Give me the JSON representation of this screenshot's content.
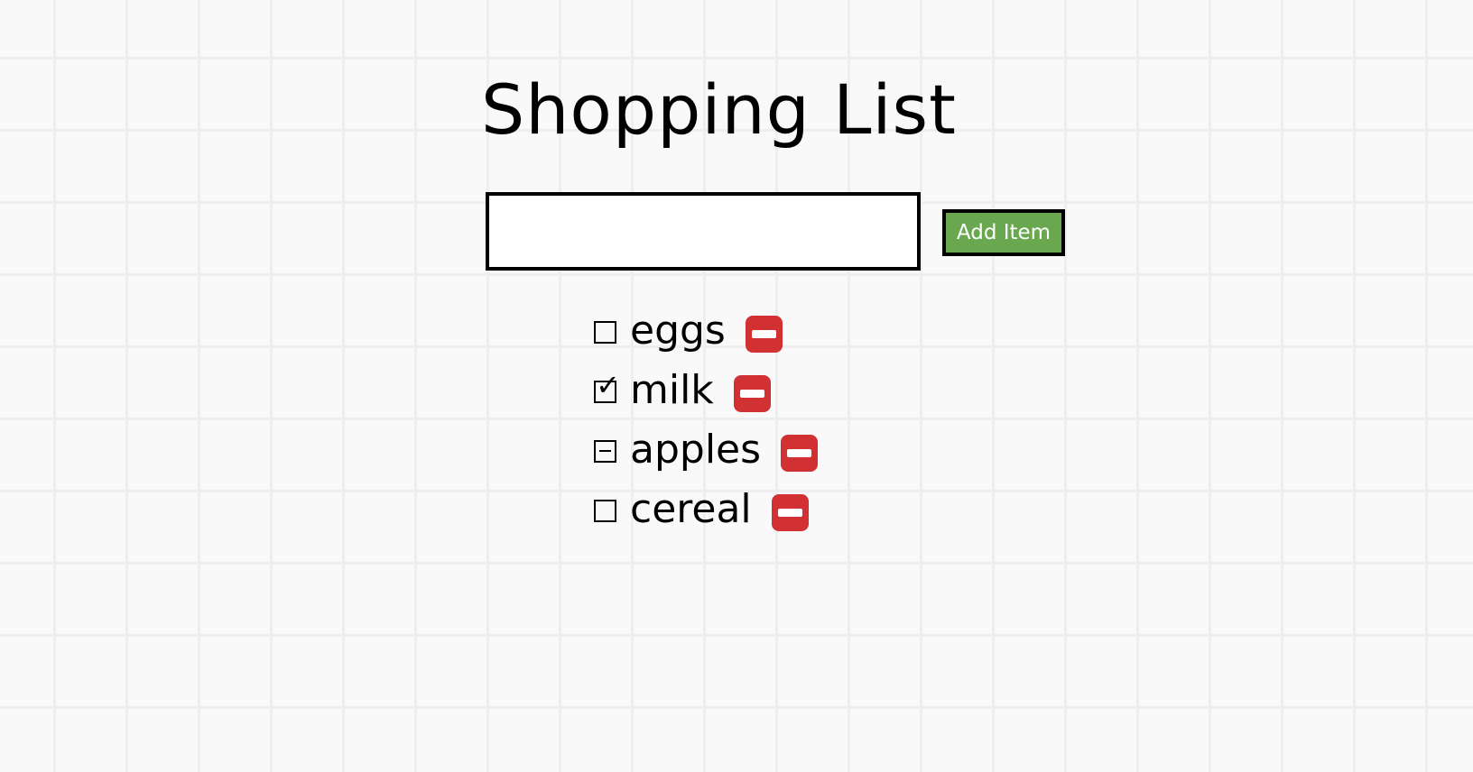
{
  "app": {
    "title": "Shopping List"
  },
  "form": {
    "input_value": "",
    "add_label": "Add Item"
  },
  "items": [
    {
      "label": "eggs",
      "state": "unchecked"
    },
    {
      "label": "milk",
      "state": "checked"
    },
    {
      "label": "apples",
      "state": "indeterminate"
    },
    {
      "label": "cereal",
      "state": "unchecked"
    }
  ],
  "icons": {
    "checkbox_checked": "checkmark-icon",
    "checkbox_indeterminate": "minus-icon",
    "remove": "remove-icon"
  },
  "colors": {
    "background": "#f9f9f9",
    "grid_line": "#eeeeee",
    "add_button": "#69a84f",
    "remove_button": "#d23133"
  }
}
